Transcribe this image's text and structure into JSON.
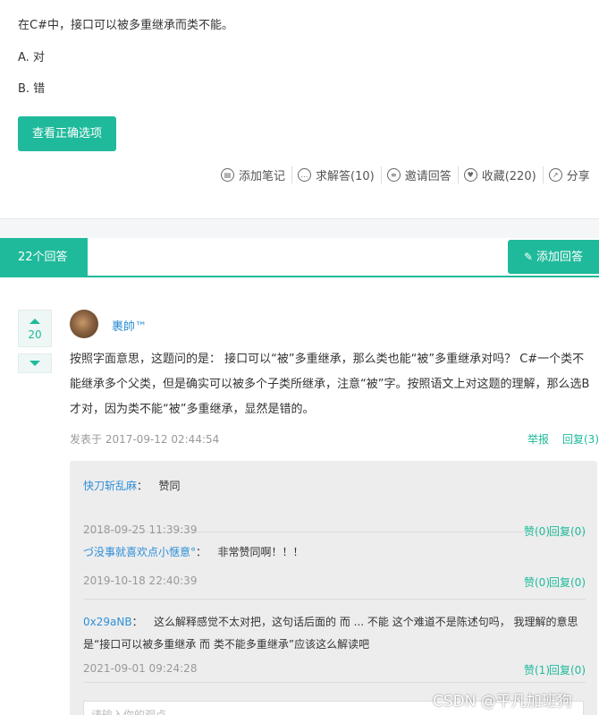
{
  "question": {
    "text": "在C#中，接口可以被多重继承而类不能。",
    "options": [
      {
        "label": "A. 对"
      },
      {
        "label": "B. 错"
      }
    ],
    "show_answer_button": "查看正确选项"
  },
  "actions": [
    {
      "icon": "note-icon",
      "label": "添加笔记"
    },
    {
      "icon": "chat-icon",
      "label": "求解答(10)"
    },
    {
      "icon": "invite-icon",
      "label": "邀请回答"
    },
    {
      "icon": "heart-icon",
      "label": "收藏(220)"
    },
    {
      "icon": "share-icon",
      "label": "分享"
    }
  ],
  "answers_bar": {
    "count_label": "22个回答",
    "add_answer_label": "添加回答"
  },
  "answer": {
    "votes": "20",
    "username": "裹帥™",
    "body": "按照字面意思，这题问的是： 接口可以“被”多重继承，那么类也能“被”多重继承对吗？ C#一个类不能继承多个父类，但是确实可以被多个子类所继承，注意“被”字。按照语文上对这题的理解，那么选B才对，因为类不能“被”多重继承，显然是错的。",
    "posted": "发表于 2017-09-12 02:44:54",
    "report": "举报",
    "reply": "回复(3)"
  },
  "comments": [
    {
      "user": "快刀斩乱麻",
      "sep": "：",
      "text": "赞同",
      "time": "2018-09-25 11:39:39",
      "like": "赞(0)",
      "reply": "回复(0)"
    },
    {
      "user": "づ没事就喜欢点小惬意°",
      "sep": "：",
      "text": "非常赞同啊！！！",
      "time": "2019-10-18 22:40:39",
      "like": "赞(0)",
      "reply": "回复(0)"
    },
    {
      "user": "0x29aNB",
      "sep": "：",
      "text": "这么解释感觉不太对把，这句话后面的 而 ... 不能 这个难道不是陈述句吗， 我理解的意思是“接口可以被多重继承 而 类不能多重继承”应该这么解读吧",
      "time": "2021-09-01 09:24:28",
      "like": "赞(1)",
      "reply": "回复(0)"
    }
  ],
  "comment_input": {
    "placeholder": "请输入你的观点"
  },
  "watermark": "CSDN @平凡加班狗",
  "colors": {
    "accent": "#1fba9b",
    "link": "#2e8fd6"
  }
}
